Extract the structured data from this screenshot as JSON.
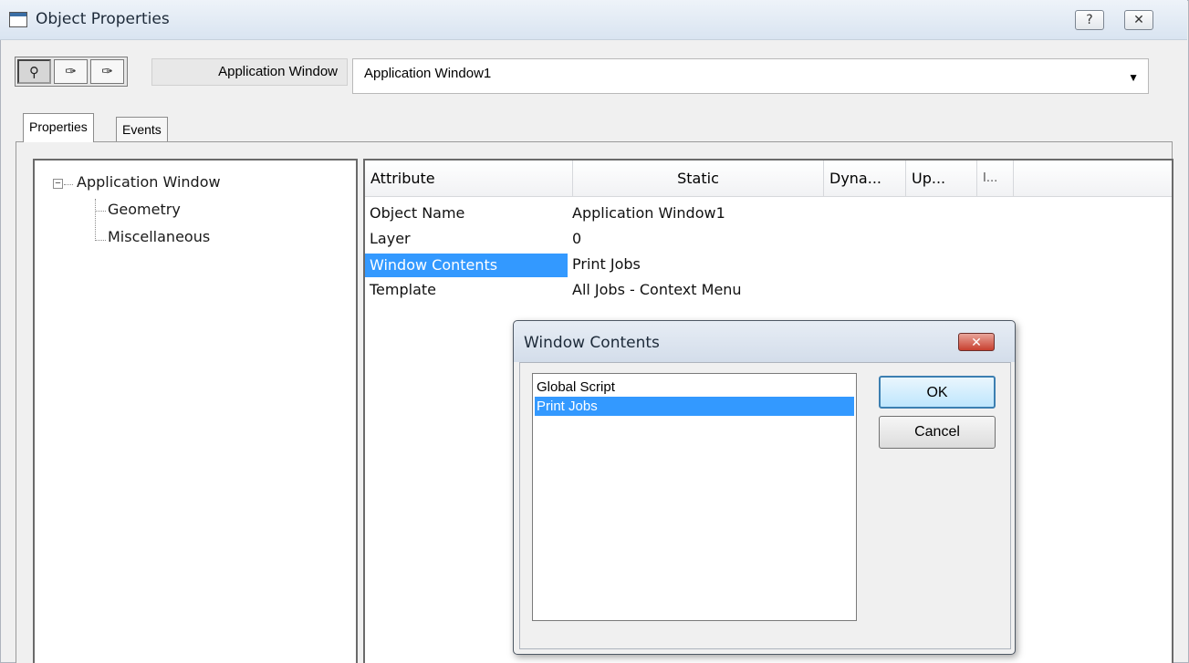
{
  "window": {
    "title": "Object Properties",
    "help_button": "?",
    "close_button": "✕"
  },
  "toolbar": {
    "tools": [
      {
        "icon": "pin-icon",
        "glyph": "⚲",
        "pressed": true
      },
      {
        "icon": "eyedropper-icon",
        "glyph": "✑",
        "pressed": false
      },
      {
        "icon": "eyedropper-icon",
        "glyph": "✑",
        "pressed": false
      }
    ],
    "object_type": "Application Window",
    "object_name": "Application Window1",
    "dropdown_arrow": "▼"
  },
  "tabs": [
    {
      "label": "Properties",
      "active": true
    },
    {
      "label": "Events",
      "active": false
    }
  ],
  "tree": {
    "root": "Application Window",
    "expander": "−",
    "children": [
      "Geometry",
      "Miscellaneous"
    ]
  },
  "grid": {
    "columns": [
      "Attribute",
      "Static",
      "Dyna...",
      "Up...",
      "I..."
    ],
    "rows": [
      {
        "attribute": "Object Name",
        "static": "Application Window1"
      },
      {
        "attribute": "Layer",
        "static": "0"
      },
      {
        "attribute": "Window Contents",
        "static": "Print Jobs",
        "selected": true
      },
      {
        "attribute": "Template",
        "static": "All Jobs - Context Menu"
      }
    ]
  },
  "dialog": {
    "title": "Window Contents",
    "close_glyph": "✕",
    "items": [
      {
        "label": "Global Script",
        "selected": false
      },
      {
        "label": "Print Jobs",
        "selected": true
      }
    ],
    "ok_label": "OK",
    "cancel_label": "Cancel"
  },
  "colors": {
    "selection": "#3399ff",
    "close_button": "#c8402f"
  }
}
